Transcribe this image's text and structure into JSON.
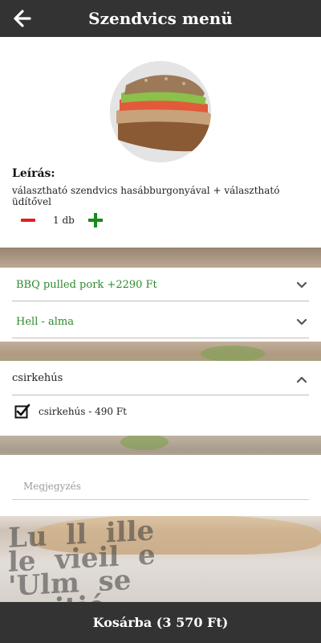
{
  "header": {
    "title": "Szendvics menü",
    "back_icon": "arrow-left-icon"
  },
  "product": {
    "image_alt": "sandwich",
    "description_label": "Leírás:",
    "description": "választható szendvics hasábburgonyával + választható üdítővel"
  },
  "quantity": {
    "value": "1 db",
    "minus_color": "#e02020",
    "plus_color": "#1a8a1a"
  },
  "selects": [
    {
      "label": "BBQ pulled pork +2290 Ft",
      "icon": "chevron-down-icon"
    },
    {
      "label": "Hell - alma",
      "icon": "chevron-down-icon"
    }
  ],
  "accordion": {
    "header": "csirkehús",
    "icon": "chevron-up-icon",
    "items": [
      {
        "label": "csirkehús - 490 Ft",
        "checked": true
      }
    ]
  },
  "note": {
    "placeholder": "Megjegyzés",
    "value": ""
  },
  "cart": {
    "label": "Kosárba (3 570 Ft)"
  },
  "colors": {
    "bar": "#333333",
    "accent_green": "#2b8a2b"
  }
}
